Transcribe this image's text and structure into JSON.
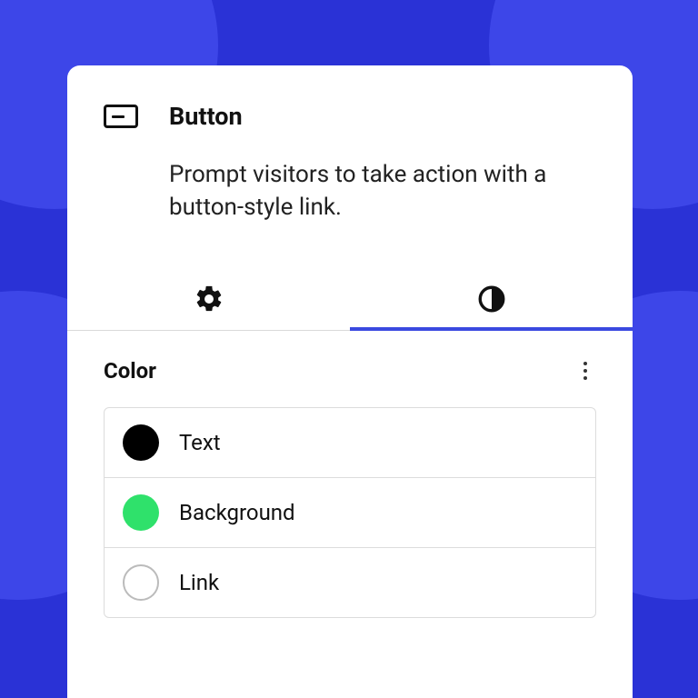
{
  "block": {
    "title": "Button",
    "description": "Prompt visitors to take action with a button-style link."
  },
  "tabs": {
    "settings_icon": "gear-icon",
    "styles_icon": "contrast-icon",
    "active": "styles"
  },
  "section": {
    "title": "Color",
    "items": [
      {
        "label": "Text",
        "color": "#000000",
        "empty": false
      },
      {
        "label": "Background",
        "color": "#2fe16b",
        "empty": false
      },
      {
        "label": "Link",
        "color": "#ffffff",
        "empty": true
      }
    ]
  },
  "colors": {
    "accent": "#3a49e0",
    "bg": "#2a32d6",
    "bg_circle": "#3d46e8"
  }
}
